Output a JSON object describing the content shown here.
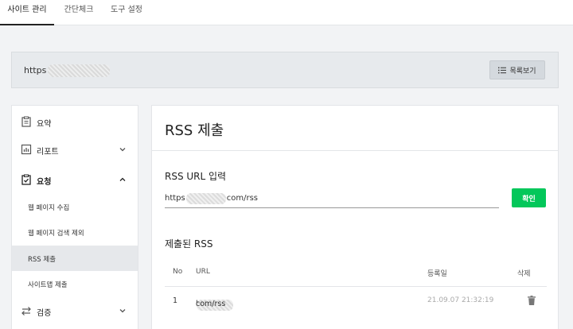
{
  "topnav": {
    "tabs": [
      {
        "label": "사이트 관리",
        "active": true
      },
      {
        "label": "간단체크",
        "active": false
      },
      {
        "label": "도구 설정",
        "active": false
      }
    ]
  },
  "site": {
    "url_prefix": "https",
    "list_button": "목록보기"
  },
  "sidebar": {
    "items": [
      {
        "label": "요약",
        "icon": "clipboard-icon"
      },
      {
        "label": "리포트",
        "icon": "chart-icon"
      },
      {
        "label": "요청",
        "icon": "checklist-icon"
      },
      {
        "label": "검증",
        "icon": "swap-icon"
      }
    ],
    "subitems": [
      {
        "label": "웹 페이지 수집"
      },
      {
        "label": "웹 페이지 검색 제외"
      },
      {
        "label": "RSS 제출"
      },
      {
        "label": "사이트맵 제출"
      }
    ]
  },
  "main": {
    "title": "RSS 제출",
    "input_label": "RSS URL 입력",
    "input_prefix": "https",
    "input_suffix": "com/rss",
    "confirm": "확인",
    "submitted_title": "제출된 RSS",
    "table": {
      "headers": [
        "No",
        "URL",
        "등록일",
        "삭제"
      ],
      "rows": [
        {
          "no": "1",
          "url_prefix": "https",
          "url_suffix": "com/rss",
          "date": "21.09.07 21:32:19"
        }
      ]
    }
  },
  "colors": {
    "accent": "#03c75a",
    "background": "#f2f3f5"
  }
}
